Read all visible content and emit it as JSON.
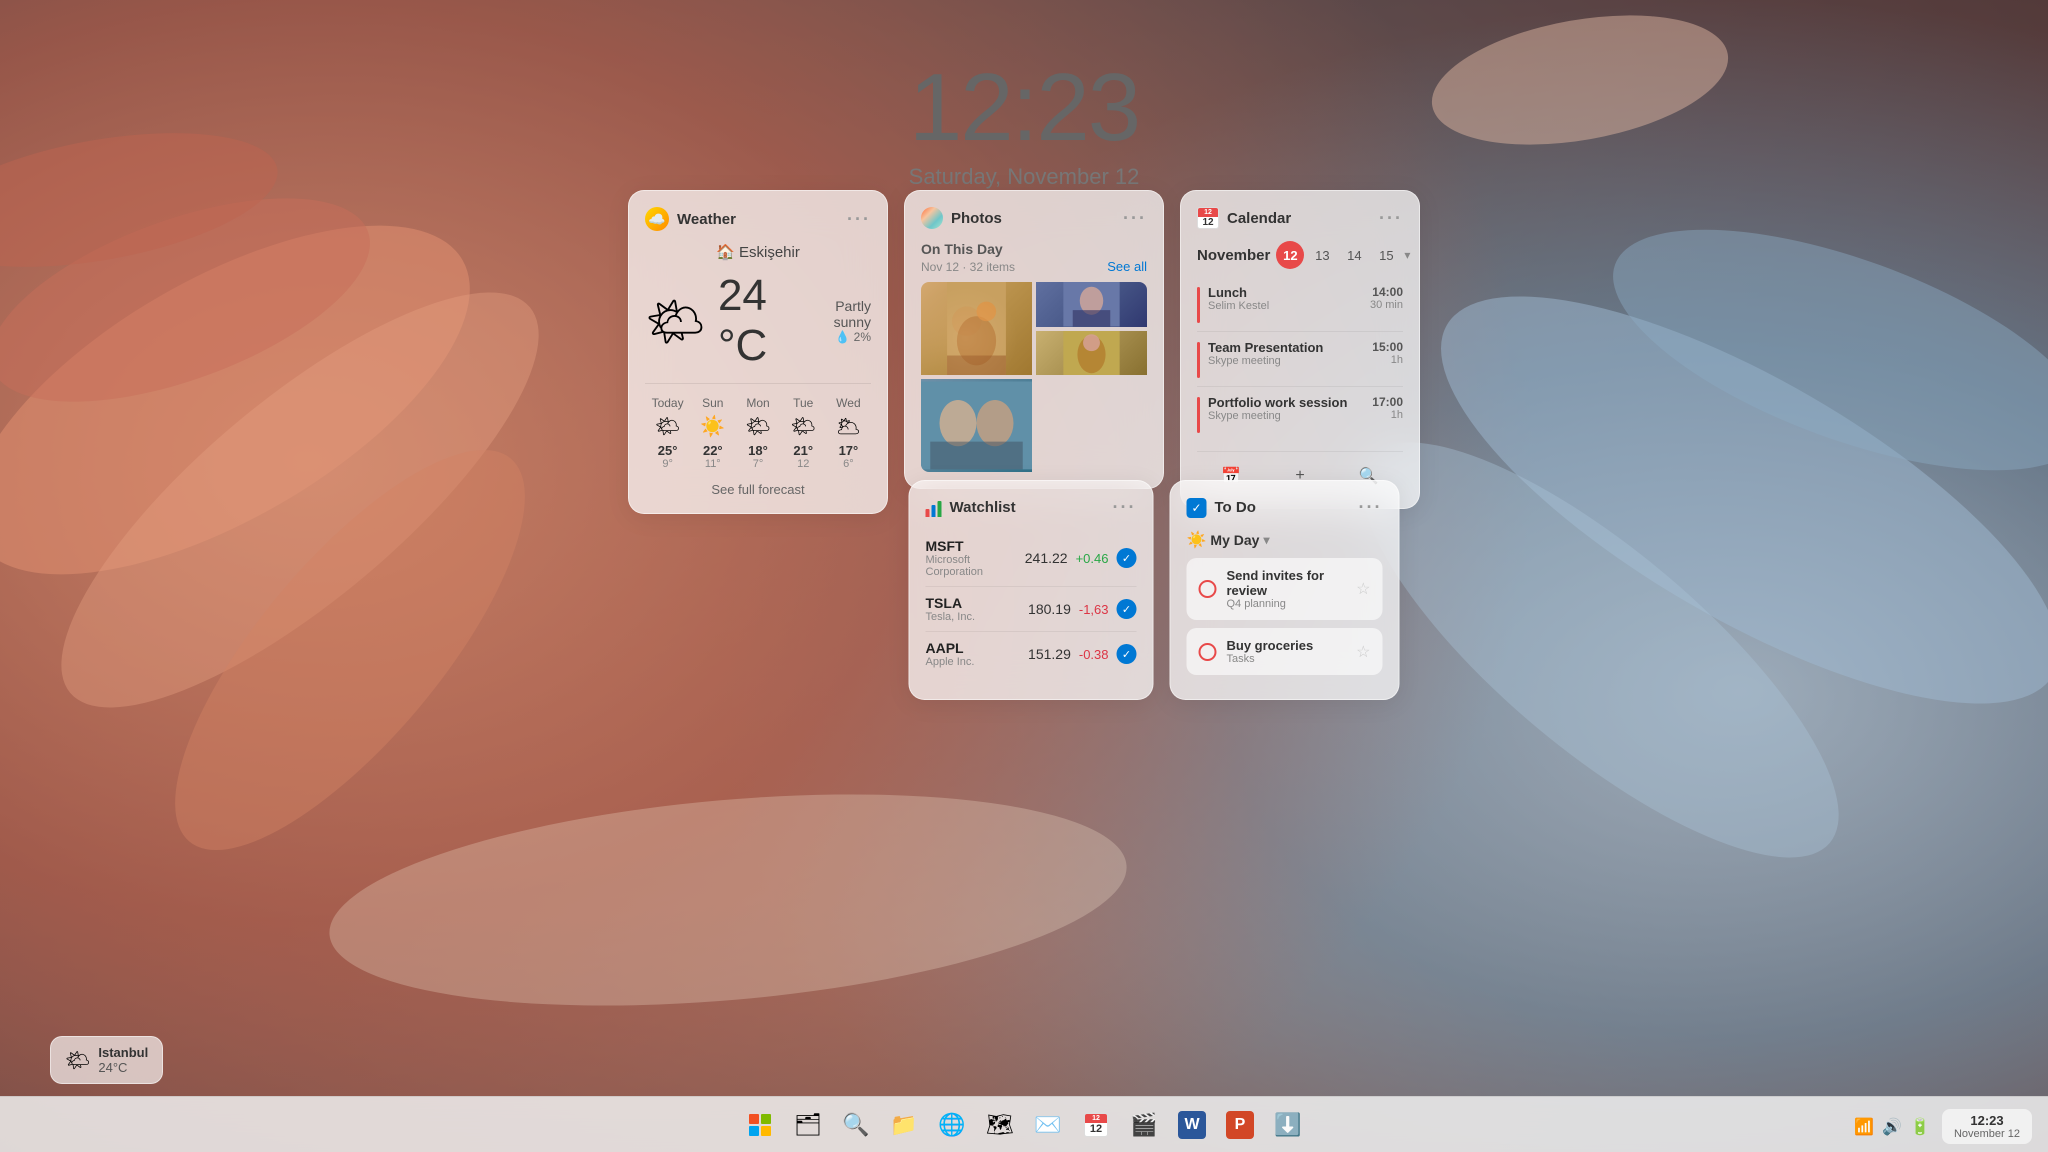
{
  "clock": {
    "time": "12:23",
    "date": "Saturday, November 12"
  },
  "weather_widget": {
    "title": "Weather",
    "location": "Eskişehir",
    "temperature": "24 °C",
    "condition": "Partly sunny",
    "humidity": "💧 2%",
    "forecast": [
      {
        "day": "Today",
        "icon": "🌤",
        "high": "25°",
        "low": "9°"
      },
      {
        "day": "Sun",
        "icon": "☀️",
        "high": "22°",
        "low": "11°"
      },
      {
        "day": "Mon",
        "icon": "🌤",
        "high": "18°",
        "low": "7°"
      },
      {
        "day": "Tue",
        "icon": "🌤",
        "high": "21°",
        "low": "12"
      },
      {
        "day": "Wed",
        "icon": "🌥",
        "high": "17°",
        "low": "6°"
      }
    ],
    "see_forecast": "See full forecast"
  },
  "photos_widget": {
    "title": "Photos",
    "on_this_day": "On This Day",
    "meta": "Nov 12 · 32 items",
    "see_all": "See all"
  },
  "calendar_widget": {
    "title": "Calendar",
    "month": "November",
    "days": [
      "12",
      "13",
      "14",
      "15"
    ],
    "active_day": "12",
    "events": [
      {
        "title": "Lunch",
        "subtitle": "Selim Kestel",
        "time": "14:00",
        "duration": "30 min"
      },
      {
        "title": "Team Presentation",
        "subtitle": "Skype meeting",
        "time": "15:00",
        "duration": "1h"
      },
      {
        "title": "Portfolio work session",
        "subtitle": "Skype meeting",
        "time": "17:00",
        "duration": "1h"
      }
    ]
  },
  "watchlist_widget": {
    "title": "Watchlist",
    "stocks": [
      {
        "ticker": "MSFT",
        "name": "Microsoft Corporation",
        "price": "241.22",
        "change": "+0.46",
        "positive": true
      },
      {
        "ticker": "TSLA",
        "name": "Tesla, Inc.",
        "price": "180.19",
        "change": "-1,63",
        "positive": false
      },
      {
        "ticker": "AAPL",
        "name": "Apple Inc.",
        "price": "151.29",
        "change": "-0.38",
        "positive": false
      }
    ]
  },
  "todo_widget": {
    "title": "To Do",
    "my_day": "My Day",
    "tasks": [
      {
        "title": "Send invites for review",
        "subtitle": "Q4 planning"
      },
      {
        "title": "Buy groceries",
        "subtitle": "Tasks"
      }
    ]
  },
  "taskbar": {
    "icons": [
      {
        "name": "windows-start",
        "symbol": "win"
      },
      {
        "name": "file-explorer",
        "symbol": "📁"
      },
      {
        "name": "search",
        "symbol": "🔍"
      },
      {
        "name": "explorer-orange",
        "symbol": "📂"
      },
      {
        "name": "edge-browser",
        "symbol": "🌐"
      },
      {
        "name": "maps",
        "symbol": "🗺"
      },
      {
        "name": "mail",
        "symbol": "✉️"
      },
      {
        "name": "calendar-taskbar",
        "symbol": "cal"
      },
      {
        "name": "clipchamp",
        "symbol": "🎬"
      },
      {
        "name": "word",
        "symbol": "W"
      },
      {
        "name": "powerpoint",
        "symbol": "P"
      },
      {
        "name": "arrow-down",
        "symbol": "⬇️"
      }
    ]
  },
  "system_tray": {
    "time": "12:23",
    "date": "November 12"
  },
  "corner_weather": {
    "city": "Istanbul",
    "temp": "24°C",
    "icon": "🌤"
  }
}
